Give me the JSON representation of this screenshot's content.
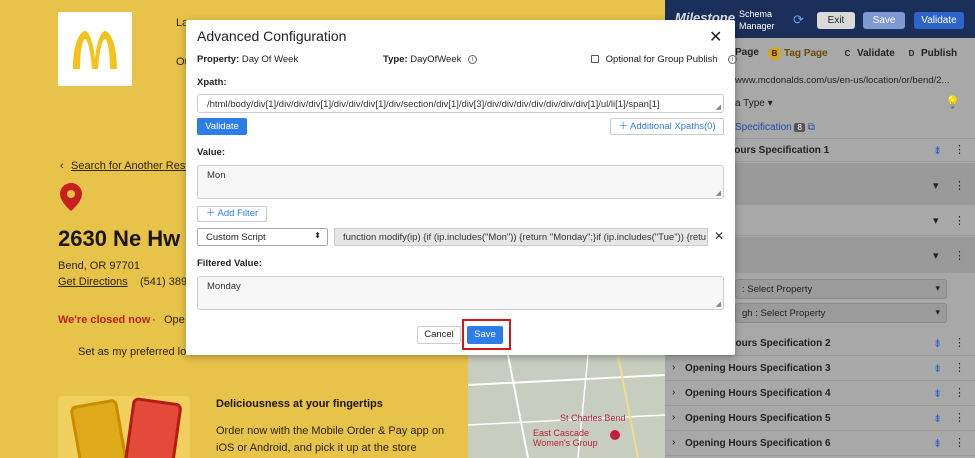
{
  "background": {
    "nav_item_1": "La",
    "nav_item_2": "Ou",
    "search_link": "Search for Another Resta",
    "store_heading": "2630 Ne Hw",
    "city": "Bend, OR 97701",
    "directions": "Get Directions",
    "phone": "(541) 389-",
    "status": "We're closed now",
    "open_text": "Ope",
    "preferred": "Set as my preferred loc",
    "promo_title": "Deliciousness at your fingertips",
    "promo_body": "Order now with the Mobile Order & Pay app on iOS or Android, and pick it up at the store",
    "map_label_1": "St Charles Bend",
    "map_label_2": "East Cascade",
    "map_label_3": "Women's Group"
  },
  "side_panel": {
    "brand": "Milestone",
    "brand_sub_1": "Schema",
    "brand_sub_2": "Manager",
    "exit": "Exit",
    "save": "Save",
    "validate": "Validate",
    "tabs": [
      {
        "badge": "",
        "label": "Page"
      },
      {
        "badge": "B",
        "label": "Tag Page"
      },
      {
        "badge": "C",
        "label": "Validate"
      },
      {
        "badge": "D",
        "label": "Publish"
      }
    ],
    "url": "www.mcdonalds.com/us/en-us/location/or/bend/2...",
    "schema_type": "a Type",
    "spec_tab": "Specification",
    "spec_count": "8",
    "rows": [
      "Hours Specification 1",
      "Opening Hours Specification 2",
      "Opening Hours Specification 3",
      "Opening Hours Specification 4",
      "Opening Hours Specification 5",
      "Opening Hours Specification 6"
    ],
    "select_prop_1": ": Select Property",
    "select_prop_2": "gh : Select Property"
  },
  "modal": {
    "title": "Advanced Configuration",
    "property_label": "Property:",
    "property_value": "Day Of Week",
    "type_label": "Type:",
    "type_value": "DayOfWeek",
    "optional_label": "Optional for Group Publish",
    "xpath_label": "Xpath:",
    "xpath_value": "/html/body/div[1]/div/div/div[1]/div/div/div[1]/div/section/div[1]/div[3]/div/div/div/div/div/div/div[1]/ul/li[1]/span[1]",
    "validate_btn": "Validate",
    "additional_xpaths": "Additional Xpaths(0)",
    "value_label": "Value:",
    "value_text": "Mon",
    "add_filter": "Add Filter",
    "filter_type": "Custom Script",
    "script_text": "function modify(ip) {if (ip.includes(\"Mon\"))    {return \"Monday\";}if (ip.includes(\"Tue\"))    {retu",
    "filtered_label": "Filtered Value:",
    "filtered_text": "Monday",
    "cancel": "Cancel",
    "save": "Save"
  }
}
